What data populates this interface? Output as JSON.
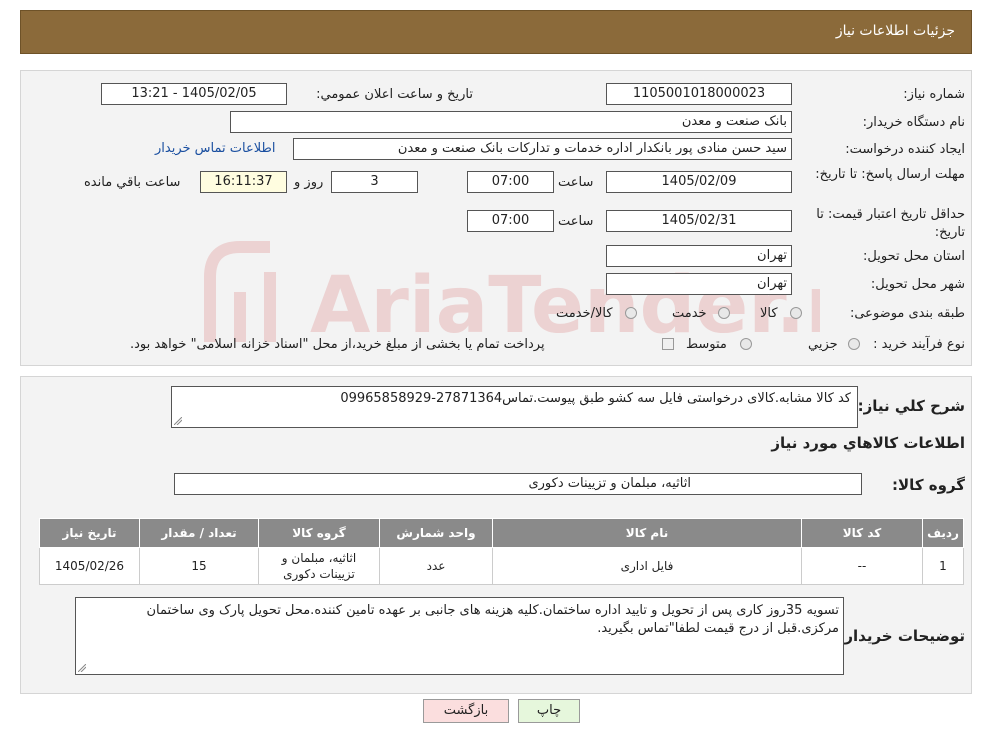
{
  "header": {
    "title": "جزئيات اطلاعات نياز"
  },
  "form": {
    "need_number_label": "شماره نياز:",
    "need_number": "1105001018000023",
    "announce_label": "تاريخ و ساعت اعلان عمومي:",
    "announce_value": "1405/02/05 - 13:21",
    "buyer_org_label": "نام دستگاه خريدار:",
    "buyer_org": "بانک صنعت و معدن",
    "creator_label": "ايجاد کننده درخواست:",
    "creator": "سید حسن منادی پور بانکدار اداره خدمات و تدارکات بانک صنعت و معدن",
    "contact_link": "اطلاعات تماس خريدار",
    "deadline_label": "مهلت ارسال پاسخ: تا تاريخ:",
    "deadline_date": "1405/02/09",
    "time_label": "ساعت",
    "deadline_time": "07:00",
    "days_value": "3",
    "days_label": "روز و",
    "remaining_time": "16:11:37",
    "remaining_label": "ساعت باقي مانده",
    "validity_label": "حداقل تاريخ اعتبار قيمت: تا تاريخ:",
    "validity_date": "1405/02/31",
    "validity_time": "07:00",
    "province_label": "استان محل تحويل:",
    "province": "تهران",
    "city_label": "شهر محل تحويل:",
    "city": "تهران",
    "category_label": "طبقه بندی موضوعی:",
    "category_options": [
      "کالا",
      "خدمت",
      "کالا/خدمت"
    ],
    "process_label": "نوع فرآيند خريد :",
    "process_options": [
      "جزيي",
      "متوسط"
    ],
    "process_note": "پرداخت تمام يا بخشی از مبلغ خريد،از محل \"اسناد خزانه اسلامی\" خواهد بود."
  },
  "summary": {
    "label": "شرح کلي نياز:",
    "text": "کد کالا مشابه.کالای درخواستی فایل سه کشو طبق پیوست.تماس27871364-09965858929"
  },
  "goods": {
    "section_title": "اطلاعات کالاهاي مورد نياز",
    "group_label": "گروه کالا:",
    "group_value": "اثاثيه، مبلمان و تزيينات دکوری",
    "columns": [
      "رديف",
      "کد کالا",
      "نام کالا",
      "واحد شمارش",
      "گروه کالا",
      "تعداد / مقدار",
      "تاريخ نياز"
    ],
    "rows": [
      {
        "row": "1",
        "code": "--",
        "name": "فایل اداری",
        "unit": "عدد",
        "group": "اثاثيه، مبلمان و تزيينات دکوری",
        "qty": "15",
        "date": "1405/02/26"
      }
    ]
  },
  "buyer_notes": {
    "label": "توضيحات خريدار:",
    "text": "تسویه 35روز کاری پس از تحویل و تایید اداره ساختمان.کلیه هزینه های جانبی بر عهده تامین کننده.محل تحویل پارک وی ساختمان مرکزی.قبل از درج قیمت لطفا\"تماس بگیرید."
  },
  "actions": {
    "print": "چاپ",
    "back": "بازگشت"
  },
  "colors": {
    "header_bg": "#8b6a3a",
    "print_bg": "#e6f7dc",
    "back_bg": "#fbdede",
    "watermark": "#e9c8c8"
  }
}
